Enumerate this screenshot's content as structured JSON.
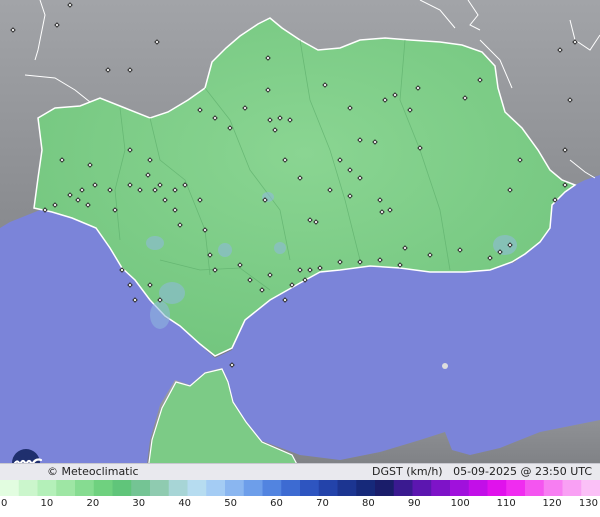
{
  "map": {
    "region": "Andalucía",
    "colors": {
      "sea": "#7b84d9",
      "land_outside": "#8d8f94",
      "region_fill": "#7fcf87",
      "region_fill_dark": "#66bd74",
      "border": "#ffffff",
      "station_marker": "#222222"
    }
  },
  "info": {
    "credit": "© Meteoclimatic",
    "product": "DGST (km/h)   05-09-2025 @ 23:50 UTC"
  },
  "legend": {
    "ticks": [
      "0",
      "10",
      "20",
      "30",
      "40",
      "50",
      "60",
      "70",
      "80",
      "90",
      "100",
      "110",
      "120",
      "130"
    ],
    "scale_min": 0,
    "scale_max": 130,
    "colors": [
      "#e2fde0",
      "#cbf6cc",
      "#b4f0b9",
      "#9ee6a4",
      "#86dc91",
      "#6fd17f",
      "#60c57a",
      "#74c494",
      "#8fcbb0",
      "#a7d5d6",
      "#b6dcf0",
      "#a4ccf4",
      "#8ab6f0",
      "#6d9eea",
      "#5284e0",
      "#3d6bd2",
      "#2e55c0",
      "#2343aa",
      "#1c3591",
      "#16297a",
      "#1a1d6a",
      "#3a1a90",
      "#5c16b0",
      "#7e13c8",
      "#a011dc",
      "#c20fe8",
      "#e012ec",
      "#f02cf0",
      "#f455f0",
      "#f77ef2",
      "#f9a0f4",
      "#fbc0f7"
    ]
  }
}
